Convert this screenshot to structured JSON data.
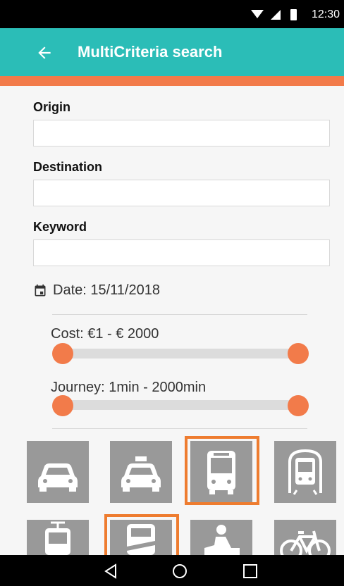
{
  "status": {
    "time": "12:30"
  },
  "appbar": {
    "title": "MultiCriteria search",
    "back_icon": "arrow-back-icon"
  },
  "form": {
    "origin_label": "Origin",
    "origin_value": "",
    "destination_label": "Destination",
    "destination_value": "",
    "keyword_label": "Keyword",
    "keyword_value": ""
  },
  "date": {
    "icon": "calendar-icon",
    "text": "Date: 15/11/2018"
  },
  "cost": {
    "label": "Cost: €1 - €  2000",
    "min": 1,
    "max": 2000,
    "range_min": 1,
    "range_max": 2000
  },
  "journey": {
    "label": "Journey: 1min -   2000min",
    "min": 1,
    "max": 2000,
    "range_min": 1,
    "range_max": 2000
  },
  "transport_modes": [
    {
      "name": "car",
      "icon": "car-icon",
      "selected": false
    },
    {
      "name": "taxi",
      "icon": "taxi-icon",
      "selected": false
    },
    {
      "name": "bus",
      "icon": "bus-icon",
      "selected": true
    },
    {
      "name": "metro",
      "icon": "metro-icon",
      "selected": false
    },
    {
      "name": "tram",
      "icon": "tram-icon",
      "selected": false
    },
    {
      "name": "train",
      "icon": "train-icon",
      "selected": true
    },
    {
      "name": "motorbike",
      "icon": "motorbike-icon",
      "selected": false
    },
    {
      "name": "bicycle",
      "icon": "bicycle-icon",
      "selected": false
    }
  ],
  "colors": {
    "appbar": "#2bbdb7",
    "accent": "#f27b4a",
    "selected_border": "#ee7c2f",
    "tile": "#999999"
  },
  "navbar": {
    "back": "nav-back-icon",
    "home": "nav-home-icon",
    "recents": "nav-recents-icon"
  }
}
